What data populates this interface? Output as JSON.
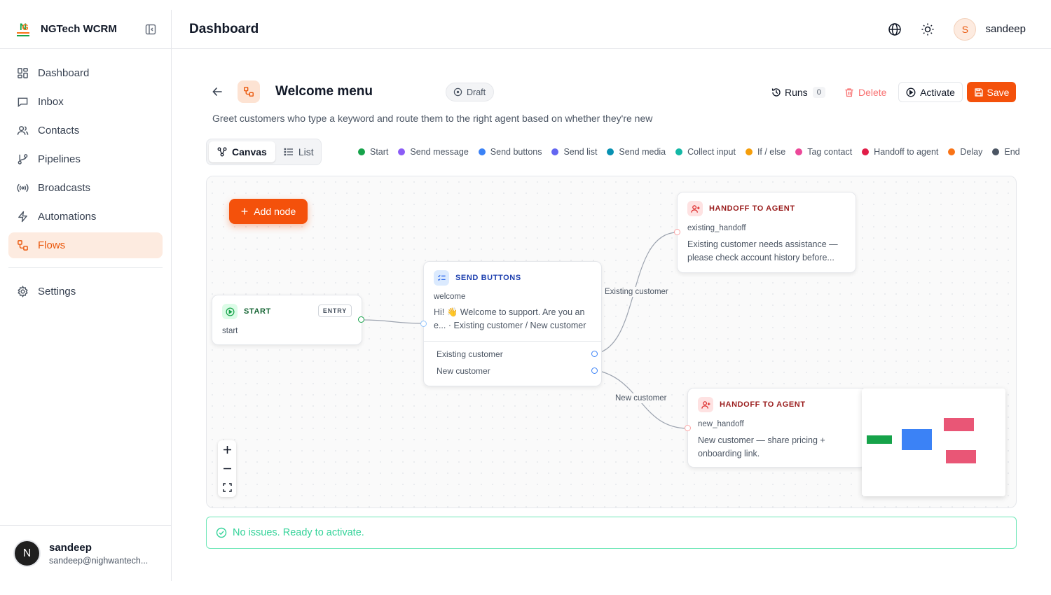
{
  "app": {
    "name": "NGTech WCRM",
    "logo_text": "NG"
  },
  "sidebar": {
    "items": [
      {
        "label": "Dashboard",
        "icon": "layout-grid-icon",
        "active": false
      },
      {
        "label": "Inbox",
        "icon": "message-square-icon",
        "active": false
      },
      {
        "label": "Contacts",
        "icon": "users-icon",
        "active": false
      },
      {
        "label": "Pipelines",
        "icon": "git-branch-icon",
        "active": false
      },
      {
        "label": "Broadcasts",
        "icon": "radio-icon",
        "active": false
      },
      {
        "label": "Automations",
        "icon": "zap-icon",
        "active": false
      },
      {
        "label": "Flows",
        "icon": "workflow-icon",
        "active": true
      }
    ],
    "settings_label": "Settings",
    "user": {
      "initial": "N",
      "name": "sandeep",
      "email": "sandeep@nighwantech..."
    }
  },
  "header": {
    "title": "Dashboard",
    "user_initial": "S",
    "user_name": "sandeep"
  },
  "flow": {
    "title": "Welcome menu",
    "status": "Draft",
    "description": "Greet customers who type a keyword and route them to the right agent based on whether they're new",
    "runs_label": "Runs",
    "runs_count": "0",
    "delete_label": "Delete",
    "activate_label": "Activate",
    "save_label": "Save"
  },
  "view_toggle": {
    "canvas": "Canvas",
    "list": "List",
    "selected": "Canvas"
  },
  "legend": [
    {
      "label": "Start",
      "color": "#16a34a"
    },
    {
      "label": "Send message",
      "color": "#8b5cf6"
    },
    {
      "label": "Send buttons",
      "color": "#3b82f6"
    },
    {
      "label": "Send list",
      "color": "#6366f1"
    },
    {
      "label": "Send media",
      "color": "#0891b2"
    },
    {
      "label": "Collect input",
      "color": "#14b8a6"
    },
    {
      "label": "If / else",
      "color": "#f59e0b"
    },
    {
      "label": "Tag contact",
      "color": "#ec4899"
    },
    {
      "label": "Handoff to agent",
      "color": "#e11d48"
    },
    {
      "label": "Delay",
      "color": "#f97316"
    },
    {
      "label": "End",
      "color": "#4b5563"
    }
  ],
  "canvas": {
    "add_node_label": "Add node",
    "nodes": {
      "start": {
        "type": "START",
        "badge": "ENTRY",
        "id": "start"
      },
      "buttons": {
        "type": "SEND BUTTONS",
        "id": "welcome",
        "body": "Hi! 👋 Welcome to support. Are you an e... · Existing customer / New customer",
        "options": [
          "Existing customer",
          "New customer"
        ]
      },
      "handoff_existing": {
        "type": "HANDOFF TO AGENT",
        "id": "existing_handoff",
        "body": "Existing customer needs assistance — please check account history before..."
      },
      "handoff_new": {
        "type": "HANDOFF TO AGENT",
        "id": "new_handoff",
        "body": "New customer — share pricing + onboarding link."
      }
    },
    "edge_labels": {
      "existing": "Existing customer",
      "new": "New customer"
    },
    "colors": {
      "start": "#16a34a",
      "buttons": "#1d4ed8",
      "handoff": "#b91c1c",
      "edge": "#9ca3af"
    }
  },
  "validation": {
    "message": "No issues. Ready to activate.",
    "color": "#34d399"
  }
}
